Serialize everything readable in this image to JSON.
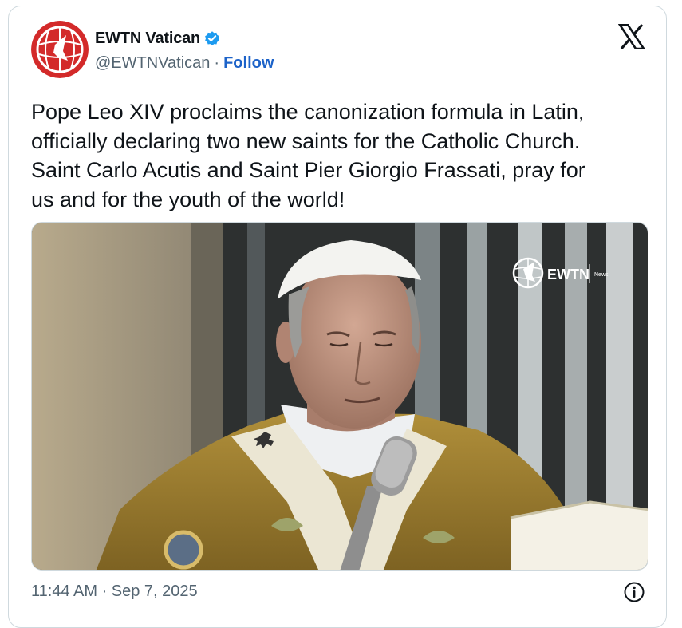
{
  "author": {
    "display_name": "EWTN Vatican",
    "handle": "@EWTNVatican",
    "separator": "·",
    "follow_label": "Follow",
    "verified_color": "#1d9bf0",
    "avatar_color": "#d32a2a"
  },
  "tweet": {
    "text": "Pope Leo XIV proclaims the canonization formula in Latin,\nofficially declaring two new saints for the Catholic Church.\nSaint Carlo Acutis and Saint Pier Giorgio Frassati, pray for\nus and for the youth of the world!"
  },
  "media": {
    "watermark_brand": "EWTN",
    "watermark_sub": "News"
  },
  "footer": {
    "timestamp": "11:44 AM · Sep 7, 2025"
  },
  "icons": {
    "platform": "x-logo-icon",
    "verified": "verified-badge-icon",
    "info": "info-icon"
  }
}
